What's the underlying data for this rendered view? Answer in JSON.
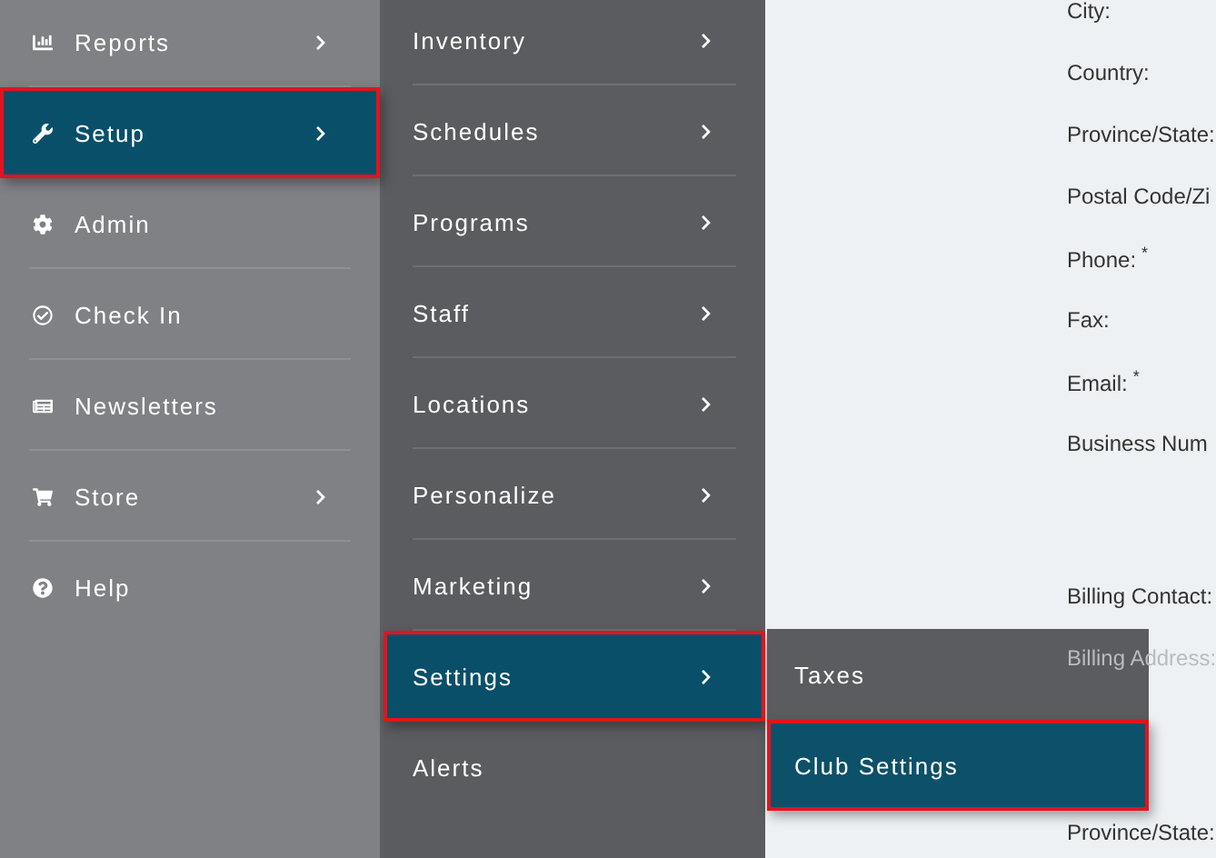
{
  "main_menu": [
    {
      "label": "Reports",
      "has_submenu": true,
      "selected": false
    },
    {
      "label": "Setup",
      "has_submenu": true,
      "selected": true
    },
    {
      "label": "Admin",
      "has_submenu": false,
      "selected": false
    },
    {
      "label": "Check In",
      "has_submenu": false,
      "selected": false
    },
    {
      "label": "Newsletters",
      "has_submenu": false,
      "selected": false
    },
    {
      "label": "Store",
      "has_submenu": true,
      "selected": false
    },
    {
      "label": "Help",
      "has_submenu": false,
      "selected": false
    }
  ],
  "setup_menu": [
    {
      "label": "Inventory",
      "has_submenu": true,
      "selected": false
    },
    {
      "label": "Schedules",
      "has_submenu": true,
      "selected": false
    },
    {
      "label": "Programs",
      "has_submenu": true,
      "selected": false
    },
    {
      "label": "Staff",
      "has_submenu": true,
      "selected": false
    },
    {
      "label": "Locations",
      "has_submenu": true,
      "selected": false
    },
    {
      "label": "Personalize",
      "has_submenu": true,
      "selected": false
    },
    {
      "label": "Marketing",
      "has_submenu": true,
      "selected": false
    },
    {
      "label": "Settings",
      "has_submenu": true,
      "selected": true
    },
    {
      "label": "Alerts",
      "has_submenu": false,
      "selected": false
    }
  ],
  "settings_menu": [
    {
      "label": "Taxes",
      "selected": false
    },
    {
      "label": "Club Settings",
      "selected": true
    }
  ],
  "form_labels": [
    {
      "kind": "field",
      "label": "City:"
    },
    {
      "kind": "field",
      "label": "Country:"
    },
    {
      "kind": "field",
      "label": "Province/State:"
    },
    {
      "kind": "field",
      "label": "Postal Code/Zi"
    },
    {
      "kind": "field",
      "label": "Phone:",
      "required_mark": "*"
    },
    {
      "kind": "field",
      "label": "Fax:"
    },
    {
      "kind": "field",
      "label": "Email:",
      "required_mark": "*"
    },
    {
      "kind": "field",
      "label": "Business Num"
    },
    {
      "kind": "group_start",
      "label": "Billing Contact:"
    },
    {
      "kind": "overlapped",
      "label": "Billing Address:"
    },
    {
      "kind": "section_start",
      "label": "Province/State:"
    }
  ]
}
